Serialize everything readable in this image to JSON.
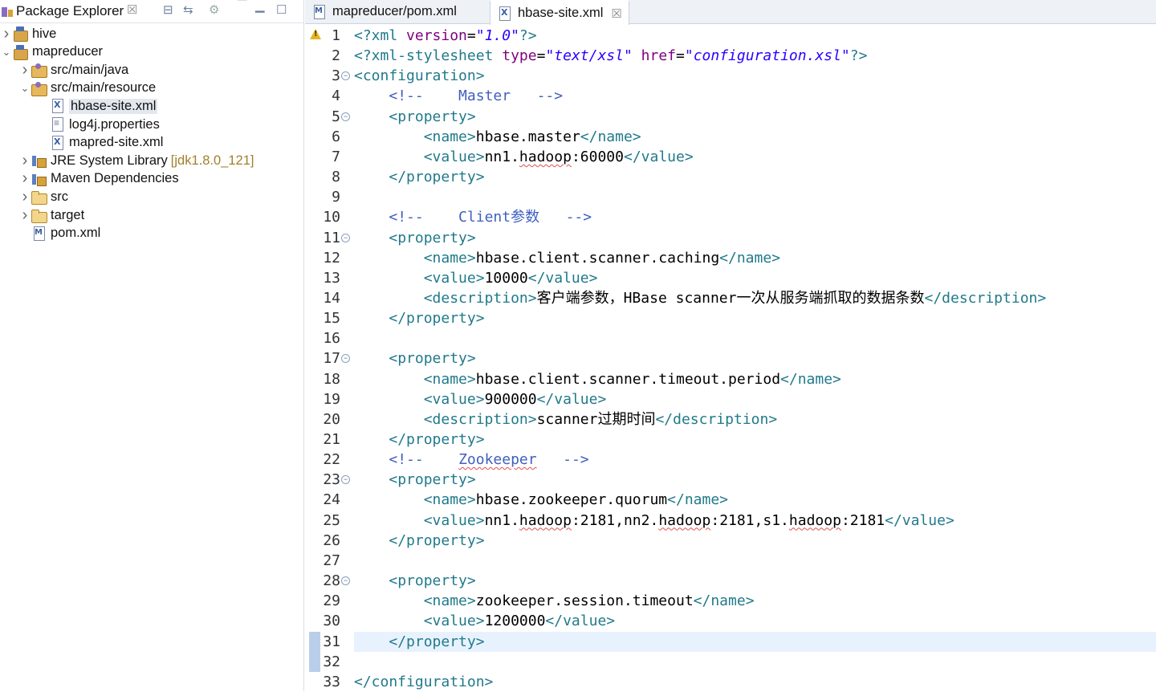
{
  "package_explorer": {
    "title": "Package Explorer",
    "close_glyph": "☒",
    "toolbar": [
      "collapse-all-icon",
      "link-with-editor-icon",
      "view-menu-icon",
      "minimize-icon",
      "maximize-icon"
    ],
    "tree": [
      {
        "label": "hive",
        "icon": "project-icon",
        "expanded": false,
        "indent": 0
      },
      {
        "label": "mapreducer",
        "icon": "project-icon",
        "expanded": true,
        "indent": 0
      },
      {
        "label": "src/main/java",
        "icon": "package-folder-icon",
        "expanded": false,
        "indent": 1
      },
      {
        "label": "src/main/resource",
        "icon": "package-folder-icon",
        "expanded": true,
        "indent": 1
      },
      {
        "label": "hbase-site.xml",
        "icon": "xml-file-icon",
        "indent": 2,
        "selected": true
      },
      {
        "label": "log4j.properties",
        "icon": "text-file-icon",
        "indent": 2
      },
      {
        "label": "mapred-site.xml",
        "icon": "xml-file-icon",
        "indent": 2
      },
      {
        "label": "JRE System Library",
        "decoration": "[jdk1.8.0_121]",
        "icon": "library-icon",
        "expanded": false,
        "indent": 1
      },
      {
        "label": "Maven Dependencies",
        "icon": "library-icon",
        "expanded": false,
        "indent": 1
      },
      {
        "label": "src",
        "icon": "folder-icon",
        "expanded": false,
        "indent": 1
      },
      {
        "label": "target",
        "icon": "folder-icon",
        "expanded": false,
        "indent": 1
      },
      {
        "label": "pom.xml",
        "icon": "maven-file-icon",
        "indent": 1
      }
    ]
  },
  "editor": {
    "tabs": [
      {
        "label": "mapreducer/pom.xml",
        "icon": "maven-file-icon",
        "active": false
      },
      {
        "label": "hbase-site.xml",
        "icon": "xml-file-icon",
        "active": true,
        "close_glyph": "☒"
      }
    ],
    "current_line": 31,
    "lines": [
      [
        [
          "pi",
          "<?xml "
        ],
        [
          "attr",
          "version"
        ],
        [
          "txt",
          "="
        ],
        [
          "str",
          "\"1.0\""
        ],
        [
          "pi",
          "?>"
        ]
      ],
      [
        [
          "pi",
          "<?xml-stylesheet "
        ],
        [
          "attr",
          "type"
        ],
        [
          "txt",
          "="
        ],
        [
          "str",
          "\"text/xsl\""
        ],
        [
          "txt",
          " "
        ],
        [
          "attr",
          "href"
        ],
        [
          "txt",
          "="
        ],
        [
          "str",
          "\"configuration.xsl\""
        ],
        [
          "pi",
          "?>"
        ]
      ],
      [
        [
          "tag",
          "<configuration>"
        ]
      ],
      [
        [
          "txt",
          "    "
        ],
        [
          "cmt",
          "<!--    Master   -->"
        ]
      ],
      [
        [
          "txt",
          "    "
        ],
        [
          "tag",
          "<property>"
        ]
      ],
      [
        [
          "txt",
          "        "
        ],
        [
          "tag",
          "<name>"
        ],
        [
          "txt",
          "hbase.master"
        ],
        [
          "tag",
          "</name>"
        ]
      ],
      [
        [
          "txt",
          "        "
        ],
        [
          "tag",
          "<value>"
        ],
        [
          "txt",
          "nn1."
        ],
        [
          "sq",
          "hadoop"
        ],
        [
          "txt",
          ":60000"
        ],
        [
          "tag",
          "</value>"
        ]
      ],
      [
        [
          "txt",
          "    "
        ],
        [
          "tag",
          "</property>"
        ]
      ],
      [],
      [
        [
          "txt",
          "    "
        ],
        [
          "cmt",
          "<!--    Client参数   -->"
        ]
      ],
      [
        [
          "txt",
          "    "
        ],
        [
          "tag",
          "<property>"
        ]
      ],
      [
        [
          "txt",
          "        "
        ],
        [
          "tag",
          "<name>"
        ],
        [
          "txt",
          "hbase.client.scanner.caching"
        ],
        [
          "tag",
          "</name>"
        ]
      ],
      [
        [
          "txt",
          "        "
        ],
        [
          "tag",
          "<value>"
        ],
        [
          "txt",
          "10000"
        ],
        [
          "tag",
          "</value>"
        ]
      ],
      [
        [
          "txt",
          "        "
        ],
        [
          "tag",
          "<description>"
        ],
        [
          "txt",
          "客户端参数，HBase scanner一次从服务端抓取的数据条数"
        ],
        [
          "tag",
          "</description>"
        ]
      ],
      [
        [
          "txt",
          "    "
        ],
        [
          "tag",
          "</property>"
        ]
      ],
      [],
      [
        [
          "txt",
          "    "
        ],
        [
          "tag",
          "<property>"
        ]
      ],
      [
        [
          "txt",
          "        "
        ],
        [
          "tag",
          "<name>"
        ],
        [
          "txt",
          "hbase.client.scanner.timeout.period"
        ],
        [
          "tag",
          "</name>"
        ]
      ],
      [
        [
          "txt",
          "        "
        ],
        [
          "tag",
          "<value>"
        ],
        [
          "txt",
          "900000"
        ],
        [
          "tag",
          "</value>"
        ]
      ],
      [
        [
          "txt",
          "        "
        ],
        [
          "tag",
          "<description>"
        ],
        [
          "txt",
          "scanner过期时间"
        ],
        [
          "tag",
          "</description>"
        ]
      ],
      [
        [
          "txt",
          "    "
        ],
        [
          "tag",
          "</property>"
        ]
      ],
      [
        [
          "txt",
          "    "
        ],
        [
          "cmt",
          "<!--    "
        ],
        [
          "sqc",
          "Zookeeper"
        ],
        [
          "cmt",
          "   -->"
        ]
      ],
      [
        [
          "txt",
          "    "
        ],
        [
          "tag",
          "<property>"
        ]
      ],
      [
        [
          "txt",
          "        "
        ],
        [
          "tag",
          "<name>"
        ],
        [
          "txt",
          "hbase.zookeeper.quorum"
        ],
        [
          "tag",
          "</name>"
        ]
      ],
      [
        [
          "txt",
          "        "
        ],
        [
          "tag",
          "<value>"
        ],
        [
          "txt",
          "nn1."
        ],
        [
          "sq",
          "hadoop"
        ],
        [
          "txt",
          ":2181,nn2."
        ],
        [
          "sq",
          "hadoop"
        ],
        [
          "txt",
          ":2181,s1."
        ],
        [
          "sq",
          "hadoop"
        ],
        [
          "txt",
          ":2181"
        ],
        [
          "tag",
          "</value>"
        ]
      ],
      [
        [
          "txt",
          "    "
        ],
        [
          "tag",
          "</property>"
        ]
      ],
      [],
      [
        [
          "txt",
          "    "
        ],
        [
          "tag",
          "<property>"
        ]
      ],
      [
        [
          "txt",
          "        "
        ],
        [
          "tag",
          "<name>"
        ],
        [
          "txt",
          "zookeeper.session.timeout"
        ],
        [
          "tag",
          "</name>"
        ]
      ],
      [
        [
          "txt",
          "        "
        ],
        [
          "tag",
          "<value>"
        ],
        [
          "txt",
          "1200000"
        ],
        [
          "tag",
          "</value>"
        ]
      ],
      [
        [
          "txt",
          "    "
        ],
        [
          "tag",
          "</property>"
        ]
      ],
      [],
      [
        [
          "tag",
          "</configuration>"
        ]
      ]
    ],
    "fold_lines": [
      3,
      5,
      11,
      17,
      23,
      28
    ],
    "warning_line": 1
  }
}
